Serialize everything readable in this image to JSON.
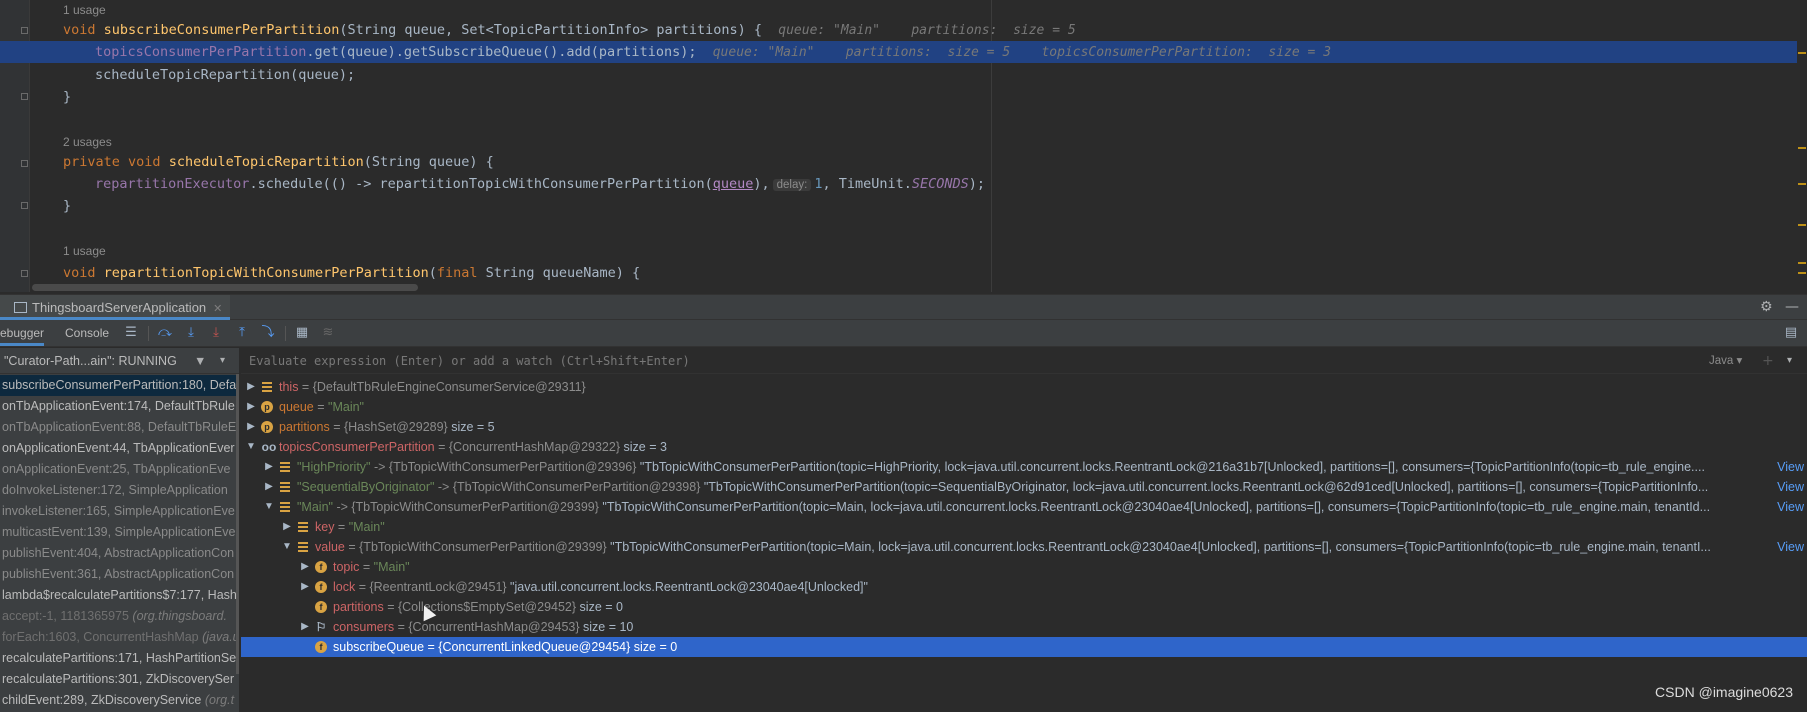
{
  "editor": {
    "usage_1": "1 usage",
    "line_1": {
      "kw": "void",
      "fn": "subscribeConsumerPerPartition",
      "rest": "(String queue, Set<TopicPartitionInfo> partitions) {",
      "hint": "queue: \"Main\"    partitions:  size = 5"
    },
    "line_2": {
      "field": "topicsConsumerPerPartition",
      "rest": ".get(queue).getSubscribeQueue().add(partitions);",
      "hint": "queue: \"Main\"    partitions:  size = 5    topicsConsumerPerPartition:  size = 3"
    },
    "line_3": {
      "text": "scheduleTopicRepartition(queue);"
    },
    "line_4": {
      "text": "}"
    },
    "usage_2": "2 usages",
    "line_5": {
      "kw": "private void",
      "fn": "scheduleTopicRepartition",
      "rest": "(String queue) {"
    },
    "line_6": {
      "field": "repartitionExecutor",
      "rest_a": ".schedule(() -> repartitionTopicWithConsumerPerPartition(",
      "param": "queue",
      "rest_b": "),",
      "hint_box": "delay:",
      "num": "1",
      "rest_c": ", TimeUnit.",
      "const": "SECONDS",
      "rest_d": ");"
    },
    "line_7": {
      "text": "}"
    },
    "usage_3": "1 usage",
    "line_8": {
      "kw": "void",
      "fn": "repartitionTopicWithConsumerPerPartition",
      "rest_a": "(",
      "kw2": "final",
      "rest_b": " String queueName) {"
    }
  },
  "run_window": {
    "tab_title": "ThingsboardServerApplication",
    "tabs": {
      "debugger": "ebugger",
      "console": "Console"
    },
    "thread_selector": "\"Curator-Path...ain\": RUNNING",
    "eval_placeholder": "Evaluate expression (Enter) or add a watch (Ctrl+Shift+Enter)",
    "eval_language": "Java",
    "icons": {
      "step_over": "step-over-icon",
      "step_into": "step-into-icon",
      "force_step_into": "force-step-into-icon",
      "step_out": "step-out-icon",
      "run_to_cursor": "run-to-cursor-icon",
      "evaluate": "evaluate-icon"
    }
  },
  "frames": [
    {
      "name": "subscribeConsumerPerPartition:180, Defa",
      "style": "active"
    },
    {
      "name": "onTbApplicationEvent:174, DefaultTbRule",
      "style": "normal"
    },
    {
      "name": "onTbApplicationEvent:88, DefaultTbRuleE",
      "style": "lib"
    },
    {
      "name": "onApplicationEvent:44, TbApplicationEver",
      "style": "normal"
    },
    {
      "name": "onApplicationEvent:25, TbApplicationEve",
      "style": "lib"
    },
    {
      "name": "doInvokeListener:172, SimpleApplication",
      "style": "lib"
    },
    {
      "name": "invokeListener:165, SimpleApplicationEve",
      "style": "lib"
    },
    {
      "name": "multicastEvent:139, SimpleApplicationEve",
      "style": "lib"
    },
    {
      "name": "publishEvent:404, AbstractApplicationCon",
      "style": "lib"
    },
    {
      "name": "publishEvent:361, AbstractApplicationCon",
      "style": "lib"
    },
    {
      "name": "lambda$recalculatePartitions$7:177, Hash",
      "style": "normal"
    },
    {
      "name": "accept:-1, 1181365975",
      "pkg": " (org.thingsboard.",
      "style": "lib2"
    },
    {
      "name": "forEach:1603, ConcurrentHashMap",
      "pkg": " (java.u",
      "style": "lib2"
    },
    {
      "name": "recalculatePartitions:171, HashPartitionSe",
      "style": "normal"
    },
    {
      "name": "recalculatePartitions:301, ZkDiscoverySer",
      "style": "normal"
    },
    {
      "name": "childEvent:289, ZkDiscoveryService",
      "pkg": " (org.t",
      "style": "normal"
    }
  ],
  "variables": [
    {
      "depth": 0,
      "arrow": "▶",
      "icon": "list",
      "name": "this",
      "name_style": "vname",
      "ref": " = {DefaultTbRuleEngineConsumerService@29311}",
      "val": "",
      "view": ""
    },
    {
      "depth": 0,
      "arrow": "▶",
      "icon": "p",
      "name": "queue",
      "name_style": "vname-p",
      "ref": " = ",
      "str": "\"Main\"",
      "val": "",
      "view": ""
    },
    {
      "depth": 0,
      "arrow": "▶",
      "icon": "p",
      "name": "partitions",
      "name_style": "vname-p",
      "ref": " = {HashSet@29289}",
      "val": "  size = 5",
      "view": ""
    },
    {
      "depth": 0,
      "arrow": "▼",
      "icon": "watch",
      "name": "topicsConsumerPerPartition",
      "name_style": "vname",
      "ref": " = {ConcurrentHashMap@29322}",
      "val": "  size = 3",
      "view": ""
    },
    {
      "depth": 1,
      "arrow": "▶",
      "icon": "list",
      "name": "\"HighPriority\"",
      "name_style": "str",
      "ref": " -> {TbTopicWithConsumerPerPartition@29396}",
      "val": " \"TbTopicWithConsumerPerPartition(topic=HighPriority, lock=java.util.concurrent.locks.ReentrantLock@216a31b7[Unlocked], partitions=[], consumers={TopicPartitionInfo(topic=tb_rule_engine....",
      "view": "View"
    },
    {
      "depth": 1,
      "arrow": "▶",
      "icon": "list",
      "name": "\"SequentialByOriginator\"",
      "name_style": "str",
      "ref": " -> {TbTopicWithConsumerPerPartition@29398}",
      "val": " \"TbTopicWithConsumerPerPartition(topic=SequentialByOriginator, lock=java.util.concurrent.locks.ReentrantLock@62d91ced[Unlocked], partitions=[], consumers={TopicPartitionInfo...",
      "view": "View"
    },
    {
      "depth": 1,
      "arrow": "▼",
      "icon": "list",
      "name": "\"Main\"",
      "name_style": "str",
      "ref": " -> {TbTopicWithConsumerPerPartition@29399}",
      "val": " \"TbTopicWithConsumerPerPartition(topic=Main, lock=java.util.concurrent.locks.ReentrantLock@23040ae4[Unlocked], partitions=[], consumers={TopicPartitionInfo(topic=tb_rule_engine.main, tenantId...",
      "view": "View"
    },
    {
      "depth": 2,
      "arrow": "▶",
      "icon": "list",
      "name": "key",
      "name_style": "vname",
      "ref": " = ",
      "str": "\"Main\"",
      "val": "",
      "view": ""
    },
    {
      "depth": 2,
      "arrow": "▼",
      "icon": "list",
      "name": "value",
      "name_style": "vname",
      "ref": " = {TbTopicWithConsumerPerPartition@29399}",
      "val": " \"TbTopicWithConsumerPerPartition(topic=Main, lock=java.util.concurrent.locks.ReentrantLock@23040ae4[Unlocked], partitions=[], consumers={TopicPartitionInfo(topic=tb_rule_engine.main, tenantI...",
      "view": "View"
    },
    {
      "depth": 3,
      "arrow": "▶",
      "icon": "f",
      "name": "topic",
      "name_style": "vname",
      "ref": " = ",
      "str": "\"Main\"",
      "val": "",
      "view": ""
    },
    {
      "depth": 3,
      "arrow": "▶",
      "icon": "f",
      "name": "lock",
      "name_style": "vname",
      "ref": " = {ReentrantLock@29451}",
      "val": " \"java.util.concurrent.locks.ReentrantLock@23040ae4[Unlocked]\"",
      "view": ""
    },
    {
      "depth": 3,
      "arrow": "",
      "icon": "f",
      "name": "partitions",
      "name_style": "vname",
      "ref": " = {Collections$EmptySet@29452}",
      "val": "  size = 0",
      "view": ""
    },
    {
      "depth": 3,
      "arrow": "▶",
      "icon": "flag",
      "name": "consumers",
      "name_style": "vname",
      "ref": " = {ConcurrentHashMap@29453}",
      "val": "  size = 10",
      "view": ""
    },
    {
      "depth": 3,
      "arrow": "",
      "icon": "f",
      "name": "subscribeQueue",
      "name_style": "vname",
      "ref": " = {ConcurrentLinkedQueue@29454}",
      "val": "  size = 0",
      "view": "",
      "selected": true
    }
  ],
  "watermark": "CSDN @imagine0623",
  "colors": {
    "accent": "#4a88c7",
    "selection": "#2f65ca",
    "editor_bg": "#2b2b2b",
    "panel_bg": "#3c3f41"
  }
}
